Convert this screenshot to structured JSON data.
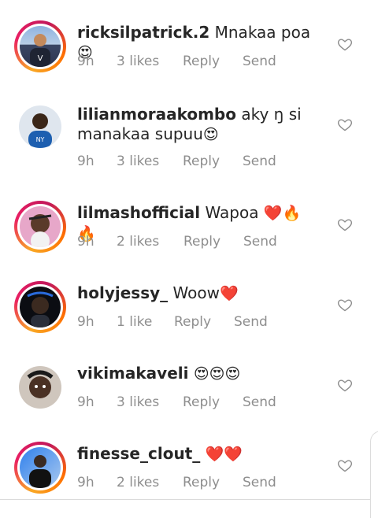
{
  "comments": [
    {
      "username": "ricksilpatrick.2",
      "text": "Mnakaa poa",
      "emoji": "😍",
      "time": "9h",
      "likes": "3 likes",
      "reply": "Reply",
      "send": "Send"
    },
    {
      "username": "lilianmoraakombo",
      "text": "aky ŋ si manakaa supuu",
      "emoji": "😍",
      "time": "9h",
      "likes": "3 likes",
      "reply": "Reply",
      "send": "Send"
    },
    {
      "username": "lilmashofficial",
      "text": "Wapoa",
      "emoji": "❤️🔥🔥",
      "time": "9h",
      "likes": "2 likes",
      "reply": "Reply",
      "send": "Send"
    },
    {
      "username": "holyjessy_",
      "text": "Woow",
      "emoji": "❤️",
      "time": "9h",
      "likes": "1 like",
      "reply": "Reply",
      "send": "Send"
    },
    {
      "username": "vikimakaveli",
      "text": "",
      "emoji": "😍😍😍",
      "time": "9h",
      "likes": "3 likes",
      "reply": "Reply",
      "send": "Send"
    },
    {
      "username": "finesse_clout_",
      "text": "",
      "emoji": "❤️❤️",
      "time": "9h",
      "likes": "2 likes",
      "reply": "Reply",
      "send": "Send"
    }
  ],
  "colors": {
    "text": "#262626",
    "muted": "#8e8e8e",
    "ring": "#e91e63"
  }
}
